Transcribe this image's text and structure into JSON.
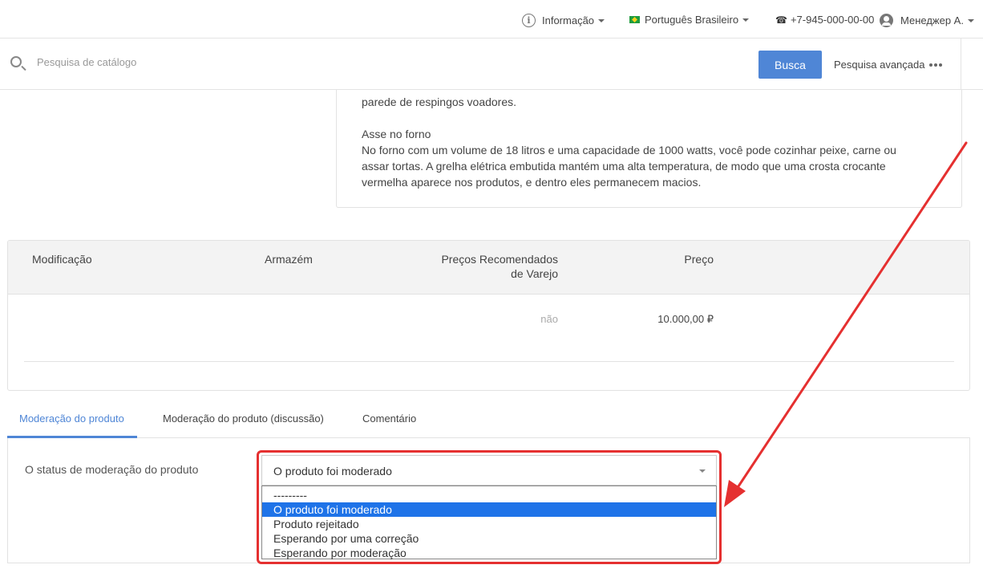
{
  "topbar": {
    "info_label": "Informação",
    "language_label": "Português Brasileiro",
    "phone": "+7-945-000-00-00",
    "user_name": "Менеджер А."
  },
  "search": {
    "placeholder": "Pesquisa de catálogo",
    "button_label": "Busca",
    "advanced_label": "Pesquisa avançada"
  },
  "description": {
    "line_cut": "parede de respingos voadores.",
    "heading": "Asse no forno",
    "paragraph_lines": [
      "No forno com um volume de 18 litros e uma capacidade de 1000 watts, você pode cozinhar peixe, carne ou",
      "assar tortas. A grelha elétrica embutida mantém uma alta temperatura, de modo que uma crosta crocante",
      "vermelha aparece nos produtos, e dentro eles permanecem macios."
    ]
  },
  "table": {
    "headers": {
      "modification": "Modificação",
      "warehouse": "Armazém",
      "rrp_line1": "Preços Recomendados",
      "rrp_line2": "de Varejo",
      "price": "Preço"
    },
    "row": {
      "rrp": "não",
      "price": "10.000,00 ₽"
    }
  },
  "tabs": [
    {
      "label": "Moderação do produto",
      "active": true
    },
    {
      "label": "Moderação do produto (discussão)",
      "active": false
    },
    {
      "label": "Comentário",
      "active": false
    }
  ],
  "moderation": {
    "label": "O status de moderação do produto",
    "selected_value": "O produto foi moderado",
    "options": [
      "---------",
      "O produto foi moderado",
      "Produto rejeitado",
      "Esperando por uma correção",
      "Esperando por moderação"
    ],
    "selected_index": 1
  },
  "colors": {
    "accent": "#4f86d6",
    "annotation_red": "#e53030",
    "option_highlight": "#1e73e8"
  }
}
